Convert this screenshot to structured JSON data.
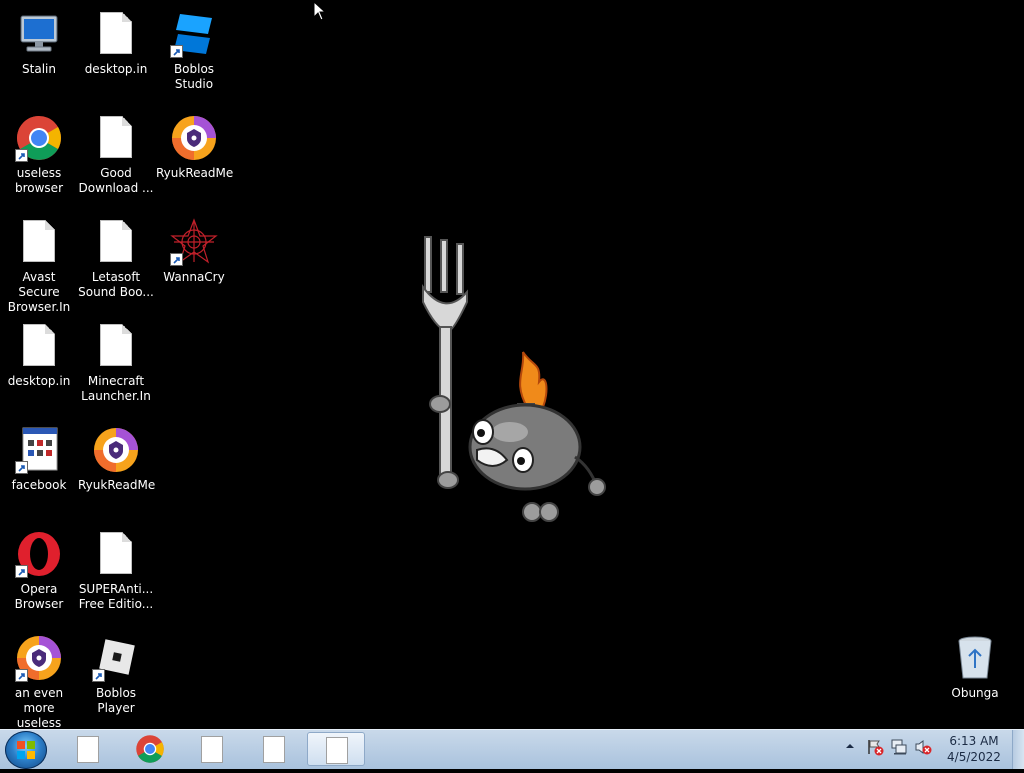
{
  "desktop": {
    "icons": [
      {
        "label": "Stalin"
      },
      {
        "label": "desktop.in"
      },
      {
        "label": "Boblos Studio"
      },
      {
        "label": "useless\nbrowser"
      },
      {
        "label": "Good\nDownload ..."
      },
      {
        "label": "RyukReadMe"
      },
      {
        "label": "Avast Secure\nBrowser.In"
      },
      {
        "label": "Letasoft\nSound Boo..."
      },
      {
        "label": "WannaCry"
      },
      {
        "label": "desktop.in"
      },
      {
        "label": "Minecraft\nLauncher.In"
      },
      {
        "label": "facebook"
      },
      {
        "label": "RyukReadMe"
      },
      {
        "label": "Opera\nBrowser"
      },
      {
        "label": "SUPERAnti...\nFree Editio..."
      },
      {
        "label": "an even more\nuseless bro..."
      },
      {
        "label": "Boblos Player"
      },
      {
        "label": "Obunga"
      }
    ],
    "wallpaper_icon": "cartoon-bomb-with-fork-icon"
  },
  "taskbar": {
    "start_icon": "windows-start-orb-icon",
    "pinned": [
      {
        "icon": "document-icon"
      },
      {
        "icon": "chrome-icon"
      },
      {
        "icon": "document-icon"
      },
      {
        "icon": "document-icon"
      },
      {
        "icon": "document-icon"
      }
    ],
    "tray_icons": [
      "show-hidden-icons-icon",
      "action-center-icon",
      "network-icon",
      "volume-muted-icon"
    ],
    "clock_time": "6:13 AM",
    "clock_date": "4/5/2022"
  },
  "colors": {
    "desktop_bg": "#000000",
    "taskbar_bg": "#b9cde3"
  }
}
